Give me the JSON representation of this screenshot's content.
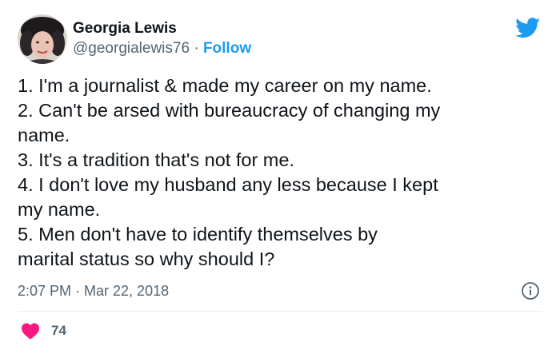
{
  "author": {
    "display_name": "Georgia Lewis",
    "handle": "@georgialewis76",
    "separator": " · ",
    "follow_label": "Follow"
  },
  "icons": {
    "brand": "twitter-bird-icon",
    "info": "info-icon",
    "like": "heart-icon"
  },
  "tweet": {
    "lines": [
      "1. I'm a journalist & made my career on my name.",
      "2. Can't be arsed with bureaucracy of changing my",
      "name.",
      "3. It's a tradition that's not for me.",
      "4. I don't love my husband any less because I kept",
      "my name.",
      "5. Men don't have to identify themselves by",
      "marital status so why should I?"
    ],
    "timestamp": "2:07 PM · Mar 22, 2018",
    "like_count": "74"
  },
  "colors": {
    "accent": "#1d9bf0",
    "like": "#f91880",
    "muted": "#536471",
    "text": "#0f1419"
  }
}
